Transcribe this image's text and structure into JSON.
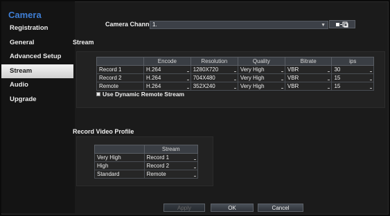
{
  "sidebar": {
    "title": "Camera",
    "items": [
      {
        "label": "Registration"
      },
      {
        "label": "General"
      },
      {
        "label": "Advanced Setup"
      },
      {
        "label": "Stream"
      },
      {
        "label": "Audio"
      },
      {
        "label": "Upgrade"
      }
    ],
    "active_index": 3
  },
  "camera_channels": {
    "label": "Camera Channels",
    "value": "1."
  },
  "stream": {
    "heading": "Stream",
    "headers": [
      "",
      "Encode",
      "Resolution",
      "Quality",
      "Bitrate",
      "ips"
    ],
    "rows": [
      [
        "Record 1",
        "H.264",
        "1280X720",
        "Very High",
        "VBR",
        "30"
      ],
      [
        "Record 2",
        "H.264",
        "704X480",
        "Very High",
        "VBR",
        "15"
      ],
      [
        "Remote",
        "H.264",
        "352X240",
        "Very High",
        "VBR",
        "15"
      ]
    ],
    "dynamic_checkbox_label": "Use Dynamic Remote Stream",
    "dynamic_checked": true
  },
  "record_video_profile": {
    "heading": "Record Video Profile",
    "headers": [
      "",
      "Stream"
    ],
    "rows": [
      [
        "Very High",
        "Record 1"
      ],
      [
        "High",
        "Record 2"
      ],
      [
        "Standard",
        "Remote"
      ]
    ]
  },
  "buttons": {
    "apply": "Apply",
    "ok": "OK",
    "cancel": "Cancel"
  },
  "colors": {
    "accent": "#3f7fd6",
    "background": "#1b1b1b"
  }
}
